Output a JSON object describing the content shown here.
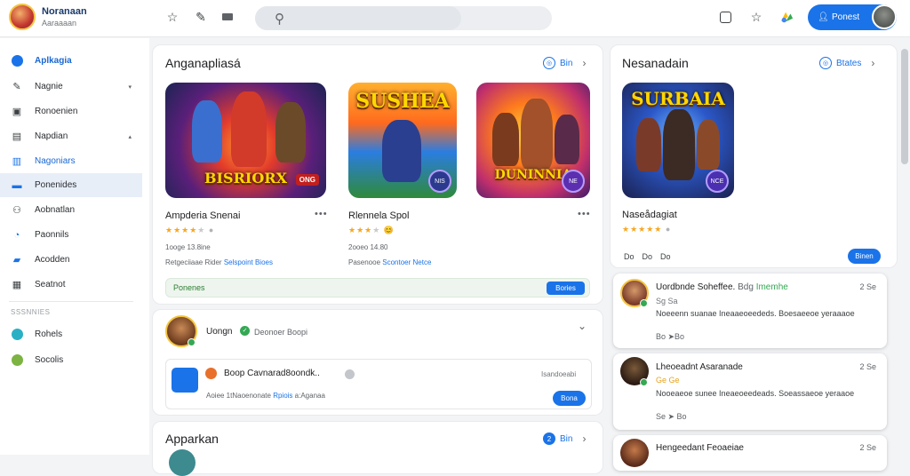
{
  "brand": {
    "name": "Noranaan",
    "subtitle": "Aaraaaan"
  },
  "topbar": {
    "icons": [
      "star-outline-icon",
      "edit-icon",
      "grid-icon"
    ],
    "right_icons": [
      "screen-icon",
      "star-plus-icon",
      "shapes-icon"
    ],
    "signin_label": "Ponest"
  },
  "sidebar": {
    "items": [
      {
        "label": "Aplkagia",
        "icon": "apps-icon",
        "chevron": ""
      },
      {
        "label": "Nagnie",
        "icon": "pencil-icon",
        "chevron": "▾"
      },
      {
        "label": "Ronoenien",
        "icon": "box-icon",
        "chevron": ""
      },
      {
        "label": "Napdian",
        "icon": "image-icon",
        "chevron": "▴"
      },
      {
        "label": "Nagoniars",
        "icon": "chart-icon",
        "chevron": ""
      },
      {
        "label": "Ponenides",
        "icon": "folder-icon",
        "chevron": ""
      },
      {
        "label": "Aobnatlan",
        "icon": "people-icon",
        "chevron": ""
      },
      {
        "label": "Paonnils",
        "icon": "clock-icon",
        "chevron": ""
      },
      {
        "label": "Acodden",
        "icon": "car-icon",
        "chevron": ""
      },
      {
        "label": "Seatnot",
        "icon": "calendar-icon",
        "chevron": ""
      }
    ],
    "section_label": "SSSNNIES",
    "extra_items": [
      {
        "label": "Rohels",
        "icon": "blue-globe-icon"
      },
      {
        "label": "Socolis",
        "icon": "green-globe-icon"
      }
    ]
  },
  "featured": {
    "title": "Anganapliasá",
    "see_all": "Bin",
    "games": [
      {
        "logo": "BISRIORX",
        "badge": "ONG",
        "name": "Ampderia Snenai",
        "rating": 3.5,
        "meta": "1ooge 13.8ine",
        "publisher": "Retgeciiaae Rider",
        "publisher_link": "Selspoint Bioes"
      },
      {
        "logo": "SUSHEA",
        "badge": "NIS",
        "name": "Rlennela Spol",
        "rating": 3,
        "meta": "2ooeo 14.80",
        "publisher": "Pasenooe",
        "publisher_link": "Scontoer Netce"
      }
    ],
    "third_logo": "DUNINNIA",
    "third_badge": "NE",
    "bar_text": "Ponenes",
    "bar_button": "Bories"
  },
  "post": {
    "user": "Uongn",
    "status": "Deonoer Boopi",
    "inner_title": "Boop Cavnarad8oondk..",
    "inner_date": "Isandoeabi",
    "inner_meta": "Aoiee 1tNaoenonate",
    "inner_link": "Rpiois",
    "inner_meta2": "a:Aganaa",
    "inner_button": "Bona"
  },
  "section2": {
    "title": "Apparkan",
    "see_all": "Bin",
    "count": "2"
  },
  "right": {
    "title": "Nesanadain",
    "see_all": "Btates",
    "game": {
      "logo": "SURBAIA",
      "badge": "NCE",
      "name": "Naseådagiat",
      "rating": 5,
      "actions": [
        "Do",
        "Do",
        "Do"
      ],
      "button": "Binen"
    },
    "comments": [
      {
        "name": "Uordbnde Soheffee.",
        "tag": "Bdg",
        "green": "Imemhe",
        "rating": "2 Se",
        "line1": "Sg Sa",
        "body": "Noeeenn suanae Ineaaeoeededs. Boesaeeoe yeraaaoe",
        "counts": "Bo ➤Bo"
      },
      {
        "name": "Lheoeadnt Asaranade",
        "tag": "",
        "green": "",
        "rating": "2 Se",
        "line1": "Ge Ge",
        "body": "Nooeaeoe sunee Ineaeoeedeads. Soeassaeoe yeraaoe",
        "counts": "Se ➤ Bo"
      },
      {
        "name": "Hengeedant Feoaeiae",
        "tag": "",
        "green": "",
        "rating": "2 Se",
        "line1": "",
        "body": "",
        "counts": ""
      }
    ]
  }
}
